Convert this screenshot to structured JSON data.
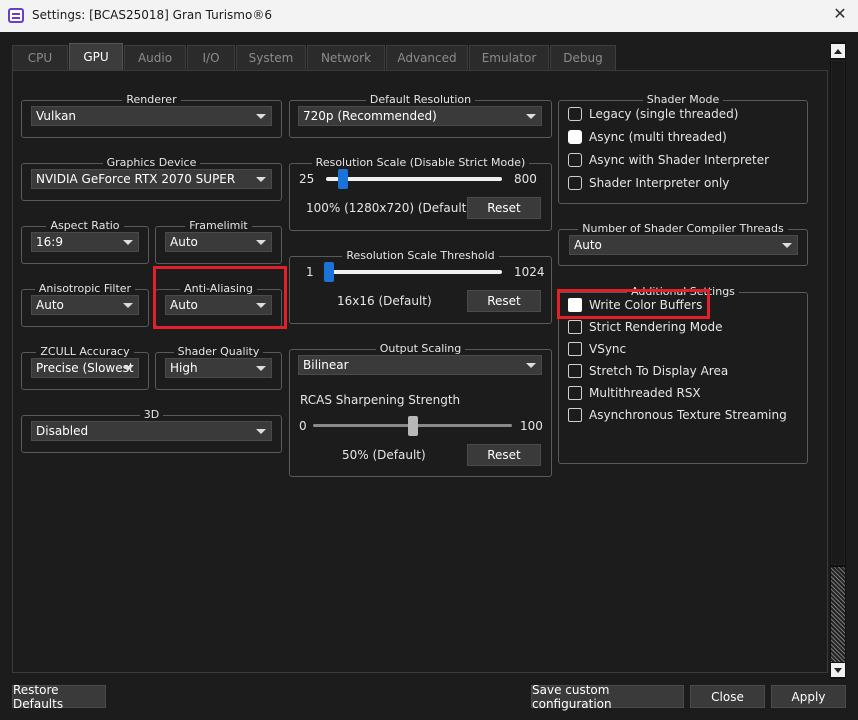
{
  "window": {
    "title": "Settings: [BCAS25018] Gran Turismo®6",
    "close_glyph": "✕"
  },
  "tabs": [
    {
      "label": "CPU",
      "active": false
    },
    {
      "label": "GPU",
      "active": true
    },
    {
      "label": "Audio",
      "active": false
    },
    {
      "label": "I/O",
      "active": false
    },
    {
      "label": "System",
      "active": false
    },
    {
      "label": "Network",
      "active": false
    },
    {
      "label": "Advanced",
      "active": false
    },
    {
      "label": "Emulator",
      "active": false
    },
    {
      "label": "Debug",
      "active": false
    }
  ],
  "renderer": {
    "title": "Renderer",
    "value": "Vulkan"
  },
  "graphics_device": {
    "title": "Graphics Device",
    "value": "NVIDIA GeForce RTX 2070 SUPER"
  },
  "aspect_ratio": {
    "title": "Aspect Ratio",
    "value": "16:9"
  },
  "framelimit": {
    "title": "Framelimit",
    "value": "Auto"
  },
  "anisotropic_filter": {
    "title": "Anisotropic Filter",
    "value": "Auto"
  },
  "anti_aliasing": {
    "title": "Anti-Aliasing",
    "value": "Auto"
  },
  "zcull_accuracy": {
    "title": "ZCULL Accuracy",
    "value": "Precise (Slowest"
  },
  "shader_quality": {
    "title": "Shader Quality",
    "value": "High"
  },
  "three_d": {
    "title": "3D",
    "value": "Disabled"
  },
  "default_resolution": {
    "title": "Default Resolution",
    "value": "720p (Recommended)"
  },
  "resolution_scale": {
    "title": "Resolution Scale (Disable Strict Mode)",
    "min_label": "25",
    "max_label": "800",
    "value_text": "100% (1280x720) (Default)",
    "level_percent": 100,
    "min": 25,
    "max": 800,
    "reset_label": "Reset"
  },
  "resolution_scale_threshold": {
    "title": "Resolution Scale Threshold",
    "min_label": "1",
    "max_label": "1024",
    "value_text": "16x16 (Default)",
    "level": 16,
    "min": 1,
    "max": 1024,
    "reset_label": "Reset"
  },
  "output_scaling": {
    "title": "Output Scaling",
    "value": "Bilinear",
    "sharpening_label": "RCAS Sharpening Strength",
    "min_label": "0",
    "max_label": "100",
    "value_text": "50% (Default)",
    "level_percent": 50,
    "reset_label": "Reset"
  },
  "shader_mode": {
    "title": "Shader Mode",
    "options": [
      {
        "label": "Legacy (single threaded)",
        "selected": false
      },
      {
        "label": "Async (multi threaded)",
        "selected": true
      },
      {
        "label": "Async with Shader Interpreter",
        "selected": false
      },
      {
        "label": "Shader Interpreter only",
        "selected": false
      }
    ]
  },
  "shader_compiler_threads": {
    "title": "Number of Shader Compiler Threads",
    "value": "Auto"
  },
  "additional_settings": {
    "title": "Additional Settings",
    "items": [
      {
        "label": "Write Color Buffers",
        "checked": true
      },
      {
        "label": "Strict Rendering Mode",
        "checked": false
      },
      {
        "label": "VSync",
        "checked": false
      },
      {
        "label": "Stretch To Display Area",
        "checked": false
      },
      {
        "label": "Multithreaded RSX",
        "checked": false
      },
      {
        "label": "Asynchronous Texture Streaming",
        "checked": false
      }
    ]
  },
  "footer": {
    "restore_defaults": "Restore Defaults",
    "save_custom": "Save custom configuration",
    "close": "Close",
    "apply": "Apply"
  },
  "colors": {
    "slider_handle": "#1a73d9",
    "slider_handle_neutral": "#b8b8b8",
    "highlight": "#e0202a",
    "icon_accent": "#6a3fc7"
  },
  "icons": {
    "app": "rpcs3-settings-icon",
    "close": "close-icon",
    "dropdown": "chevron-down-icon",
    "scroll_up": "scroll-up-icon",
    "scroll_down": "scroll-down-icon"
  }
}
